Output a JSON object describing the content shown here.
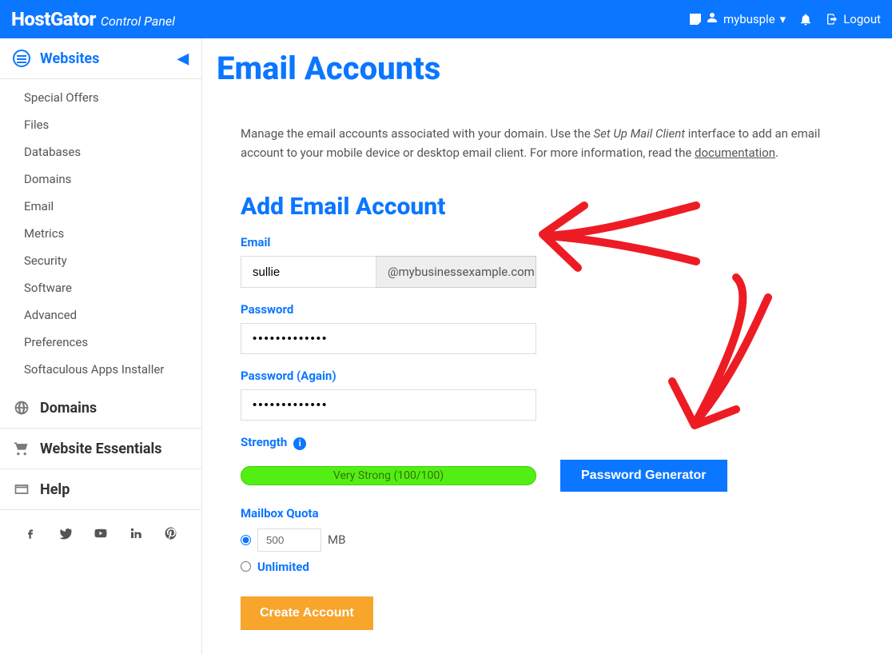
{
  "topbar": {
    "brand": "HostGator",
    "subtitle": "Control Panel",
    "username": "mybusple",
    "logout": "Logout"
  },
  "sidebar": {
    "section_websites": "Websites",
    "items": [
      "Special Offers",
      "Files",
      "Databases",
      "Domains",
      "Email",
      "Metrics",
      "Security",
      "Software",
      "Advanced",
      "Preferences",
      "Softaculous Apps Installer"
    ],
    "section_domains": "Domains",
    "section_essentials": "Website Essentials",
    "section_help": "Help"
  },
  "page": {
    "title": "Email Accounts",
    "intro_pre": "Manage the email accounts associated with your domain. Use the ",
    "intro_em": "Set Up Mail Client",
    "intro_mid": " interface to add an email account to your mobile device or desktop email client. For more information, read the ",
    "intro_link": "documentation",
    "intro_post": "."
  },
  "form": {
    "heading": "Add Email Account",
    "email_label": "Email",
    "email_value": "sullie",
    "email_domain": "@mybusinessexample.com",
    "password_label": "Password",
    "password_value": "•••••••••••••",
    "password_again_label": "Password (Again)",
    "password_again_value": "•••••••••••••",
    "strength_label": "Strength",
    "strength_text": "Very Strong (100/100)",
    "pw_generator_btn": "Password Generator",
    "quota_label": "Mailbox Quota",
    "quota_value": "500",
    "quota_unit": "MB",
    "quota_unlimited": "Unlimited",
    "create_btn": "Create Account"
  }
}
